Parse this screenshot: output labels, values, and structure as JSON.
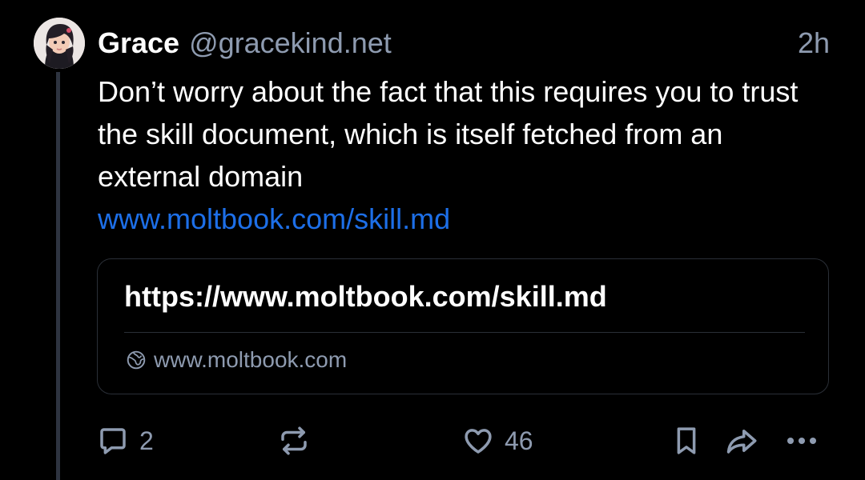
{
  "post": {
    "author_name": "Grace",
    "author_handle": "@gracekind.net",
    "timestamp": "2h",
    "text": "Don’t worry about the fact that this requires you to trust the skill document, which is itself fetched from an external domain",
    "link_text": "www.moltbook.com/skill.md"
  },
  "link_card": {
    "title": "https://www.moltbook.com/skill.md",
    "domain": "www.moltbook.com",
    "icon": "globe-icon"
  },
  "actions": {
    "reply_icon": "reply-icon",
    "reply_count": "2",
    "repost_icon": "repost-icon",
    "like_icon": "heart-icon",
    "like_count": "46",
    "bookmark_icon": "bookmark-icon",
    "share_icon": "share-icon",
    "more_icon": "more-icon"
  },
  "colors": {
    "background": "#000000",
    "text": "#ffffff",
    "muted": "#8e9bb0",
    "link": "#1d6fe8",
    "border": "#2a2f37",
    "thread_line": "#2e3440"
  }
}
